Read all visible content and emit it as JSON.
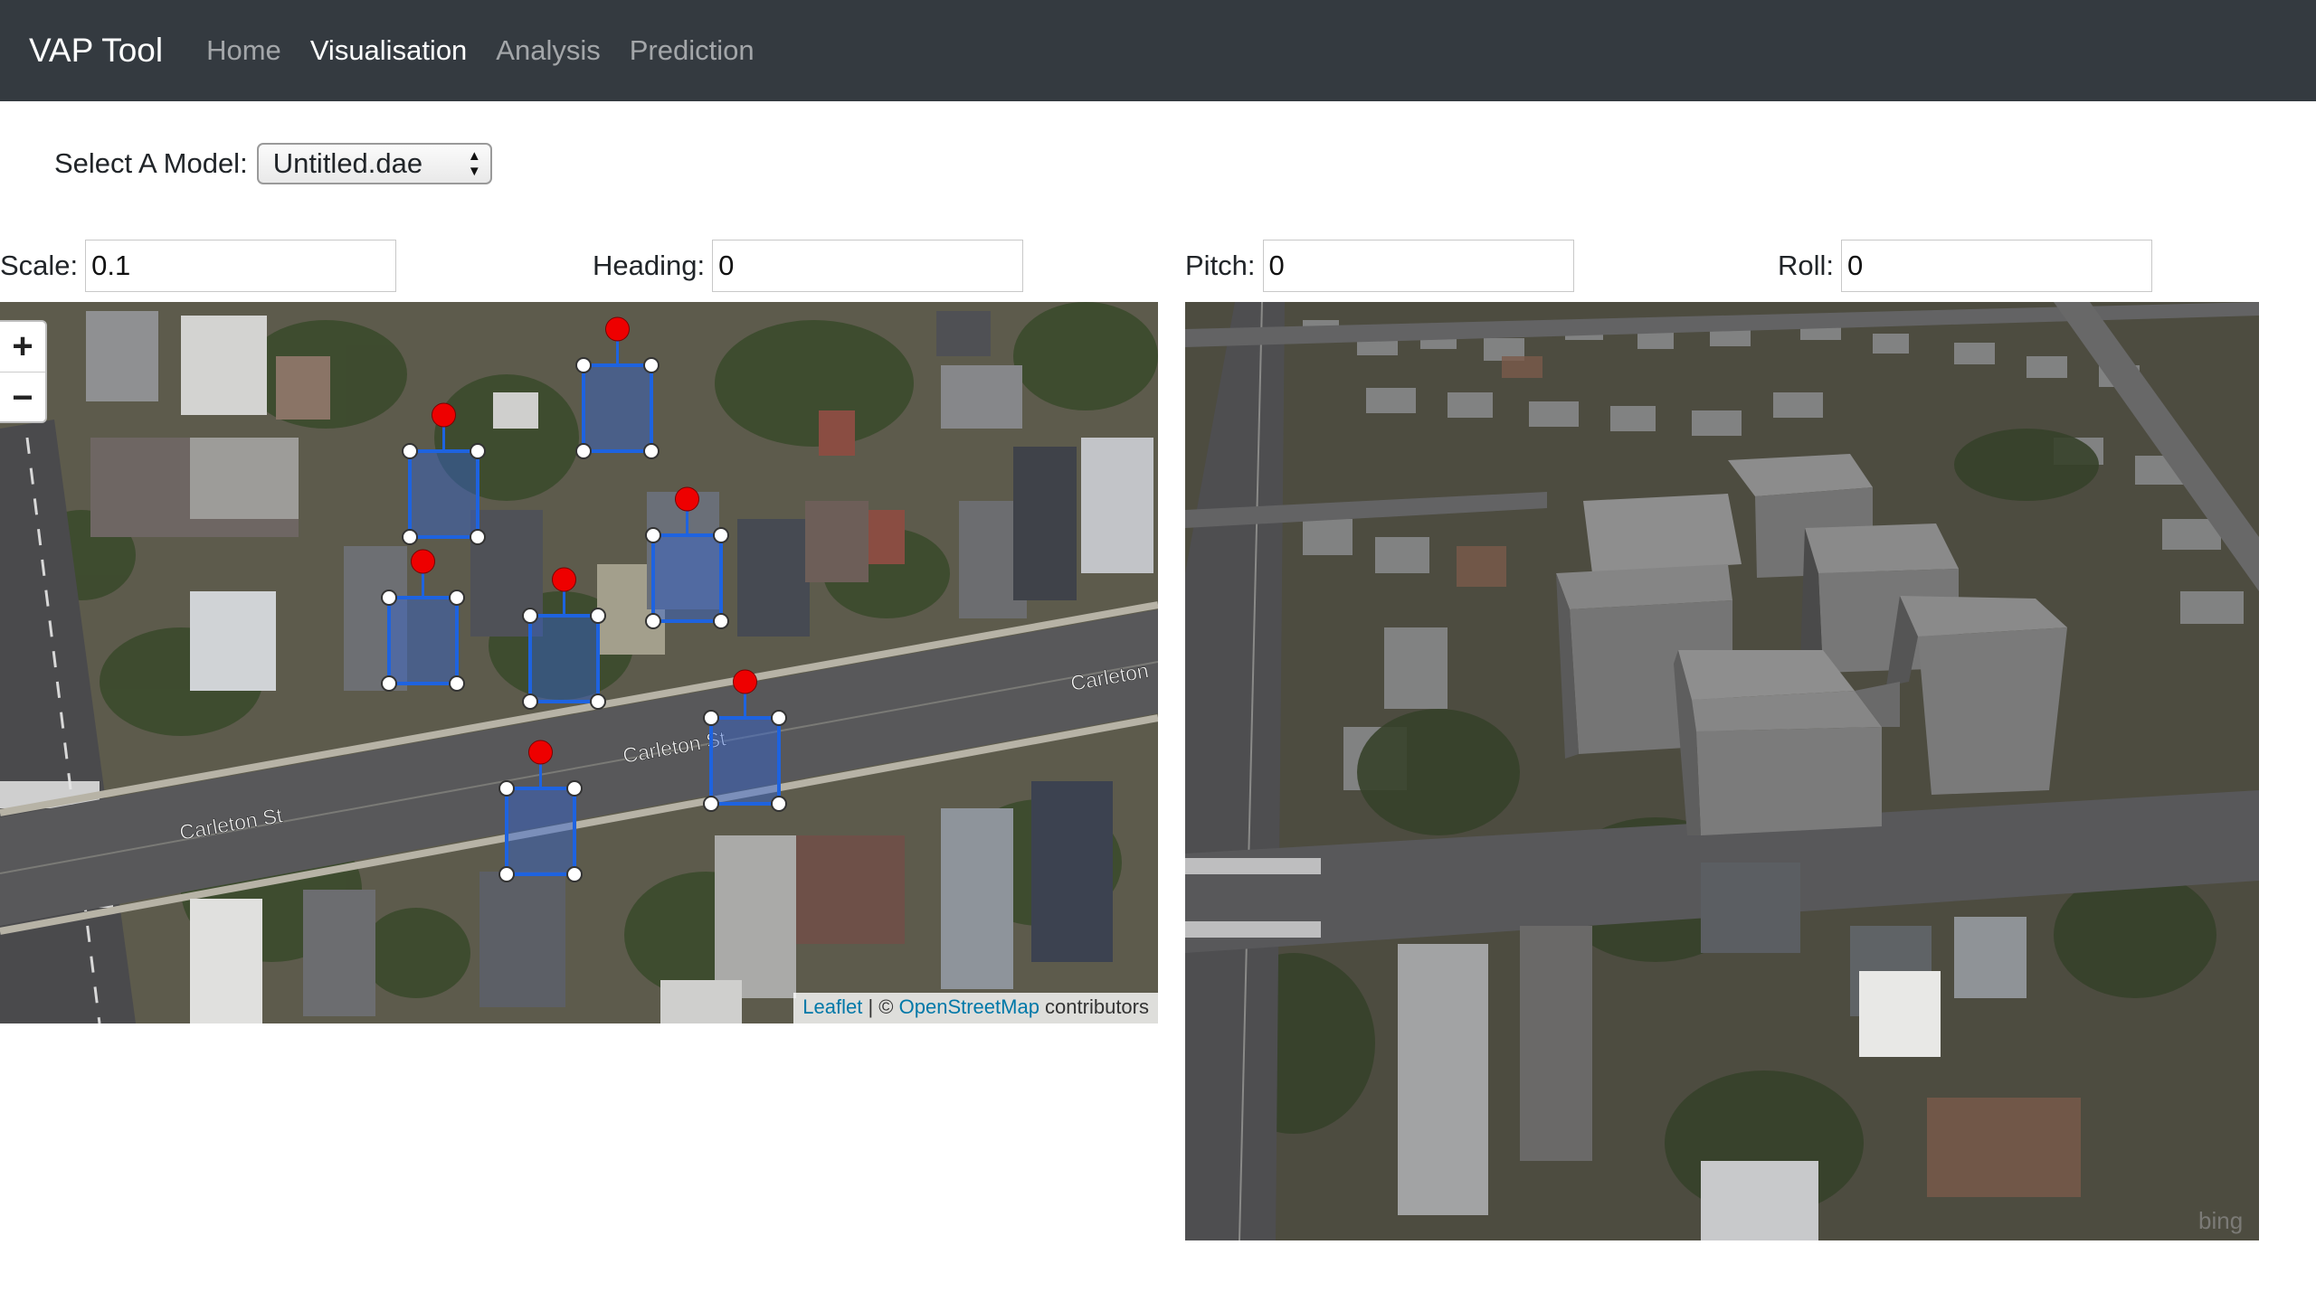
{
  "navbar": {
    "brand": "VAP Tool",
    "links": [
      {
        "label": "Home",
        "active": false
      },
      {
        "label": "Visualisation",
        "active": true
      },
      {
        "label": "Analysis",
        "active": false
      },
      {
        "label": "Prediction",
        "active": false
      }
    ]
  },
  "model_select": {
    "label": "Select A Model:",
    "value": "Untitled.dae"
  },
  "params": {
    "scale": {
      "label": "Scale:",
      "value": "0.1"
    },
    "heading": {
      "label": "Heading:",
      "value": "0"
    },
    "pitch": {
      "label": "Pitch:",
      "value": "0"
    },
    "roll": {
      "label": "Roll:",
      "value": "0"
    }
  },
  "map2d": {
    "zoom_in": "+",
    "zoom_out": "−",
    "street_labels": [
      "Carleton St",
      "Carleton St",
      "Carleton"
    ],
    "attribution": {
      "leaflet": "Leaflet",
      "sep": " | © ",
      "osm": "OpenStreetMap",
      "suffix": " contributors"
    },
    "colors": {
      "marker": "#ee0000",
      "footprint": "#1e63e0"
    }
  },
  "view3d": {
    "watermark": "bing"
  }
}
